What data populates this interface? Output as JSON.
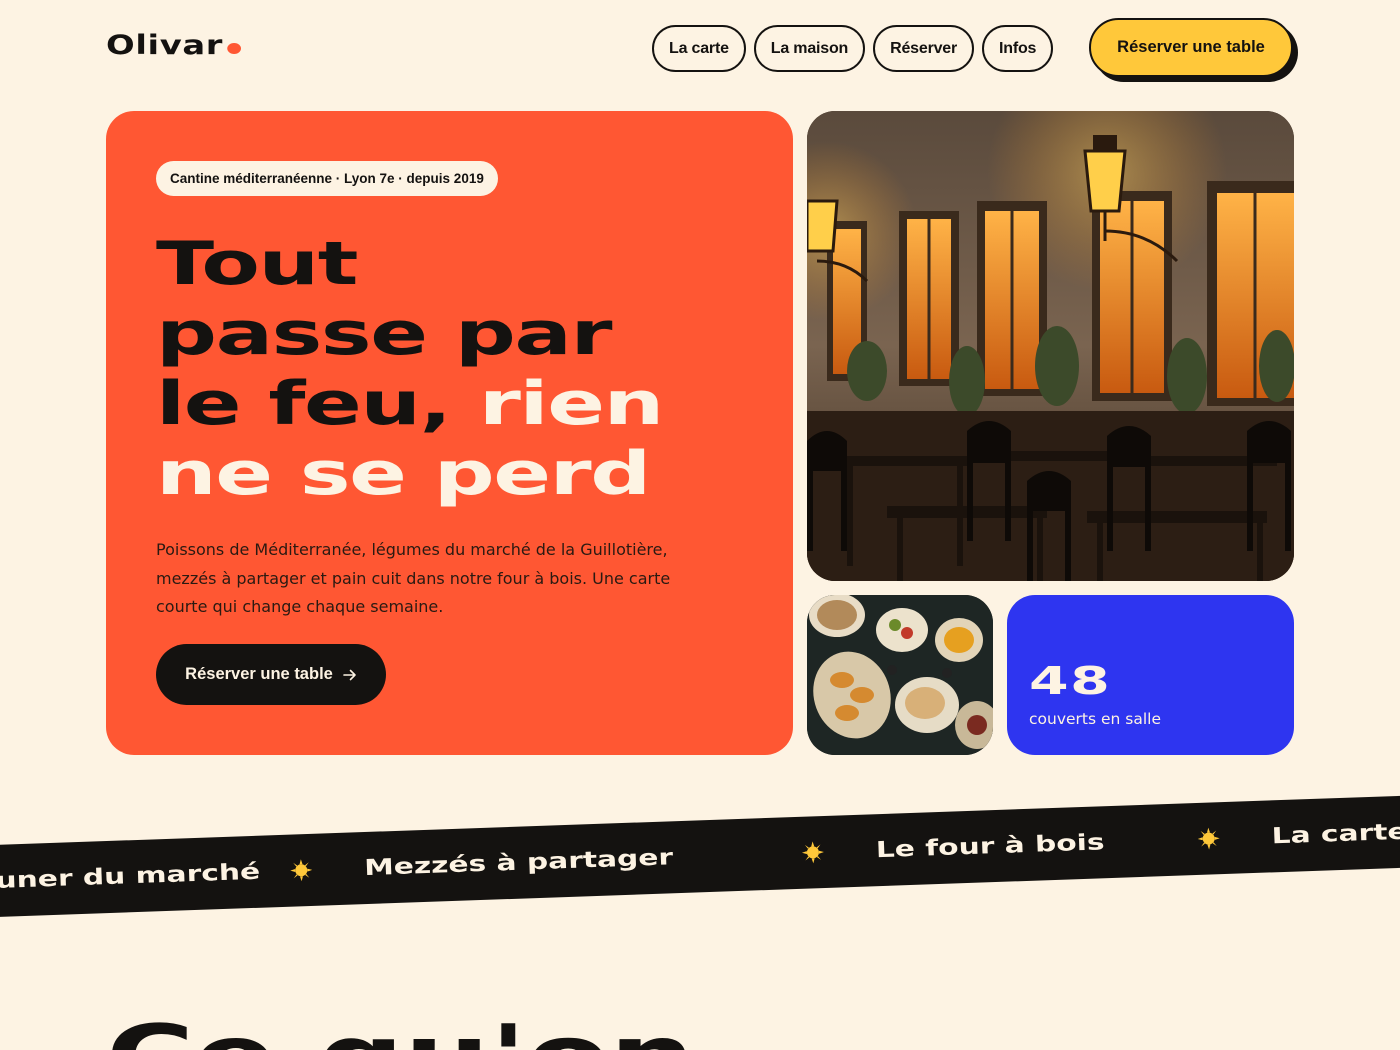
{
  "brand": {
    "name": "Olivar",
    "accent": "#ff5733",
    "yellow": "#ffc83a",
    "blue": "#2e35f0",
    "dark": "#141210",
    "cream": "#fdf3e3"
  },
  "nav": {
    "items": [
      "La carte",
      "La maison",
      "Réserver",
      "Infos"
    ],
    "cta_label": "Réserver une table"
  },
  "hero": {
    "tag": "Cantine méditerranéenne · Lyon 7e · depuis 2019",
    "headline_lines": [
      "Tout",
      "passe par",
      "le feu,",
      "rien",
      "ne se perd"
    ],
    "description": "Poissons de Méditerranée, légumes du marché de la Guillotière, mezzés à partager et pain cuit dans notre four à bois. Une carte courte qui change chaque semaine.",
    "cta_label": "Réserver une table",
    "cta_icon": "arrow-right-icon"
  },
  "photos": {
    "main_alt": "restaurant-terrace-photo",
    "small_alt": "mezze-plates-photo"
  },
  "stat": {
    "value": "48",
    "label": "couverts en salle"
  },
  "marquee": {
    "items": [
      "Déjeuner du marché",
      "Mezzés à partager",
      "Le four à bois",
      "La carte"
    ],
    "separator_icon": "sun-icon"
  },
  "section": {
    "heading": "Ce qu'on"
  }
}
